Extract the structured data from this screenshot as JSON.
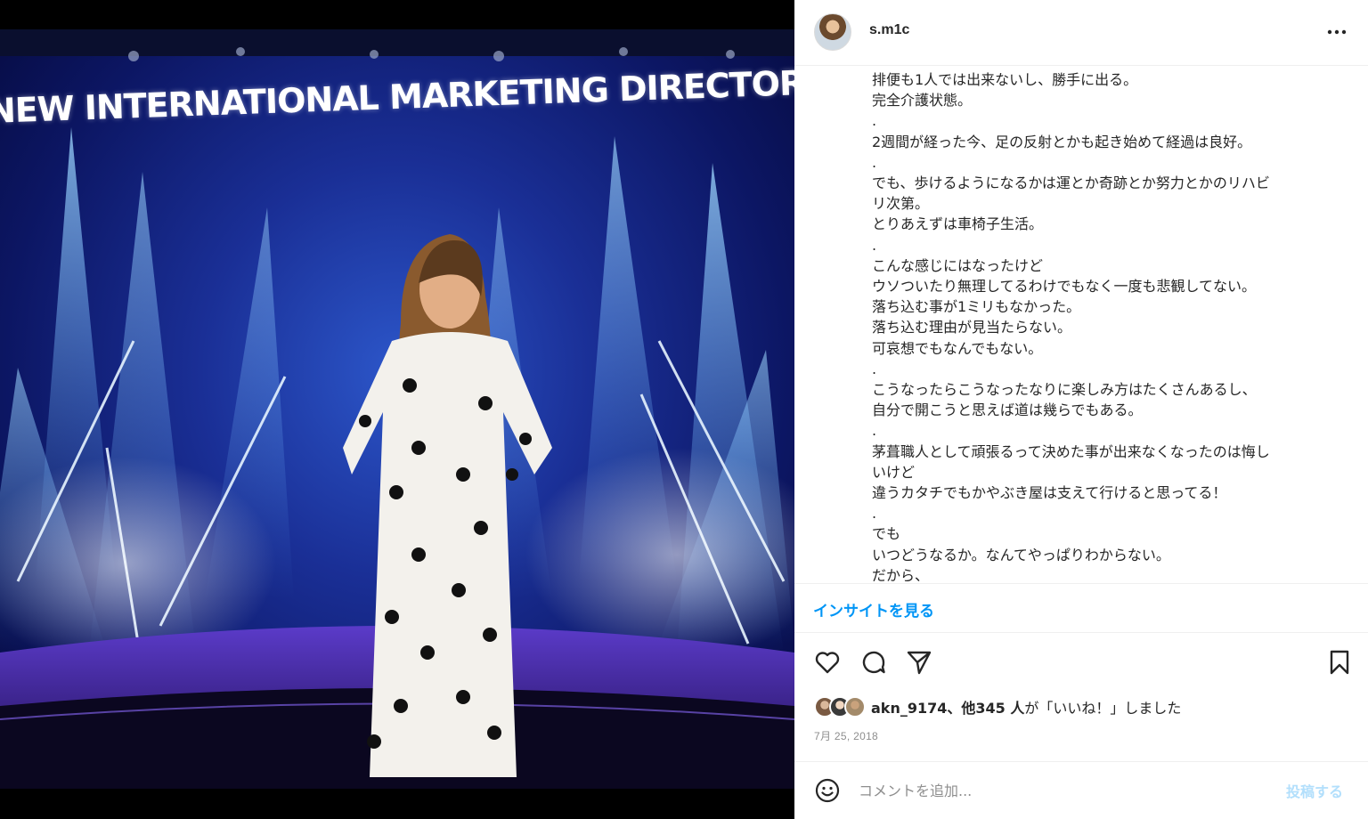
{
  "photo": {
    "stage_text": "NEW INTERNATIONAL MARKETING DIRECTOR"
  },
  "header": {
    "username": "s.m1c",
    "more_icon": "more-horizontal-icon"
  },
  "caption": {
    "lines": [
      "排便も1人では出来ないし、勝手に出る。",
      "完全介護状態。",
      ".",
      "2週間が経った今、足の反射とかも起き始めて経過は良好。",
      ".",
      "でも、歩けるようになるかは運とか奇跡とか努力とかのリハビ",
      "リ次第。",
      "とりあえずは車椅子生活。",
      ".",
      "こんな感じにはなったけど",
      "ウソついたり無理してるわけでもなく一度も悲観してない。",
      "落ち込む事が1ミリもなかった。",
      "落ち込む理由が見当たらない。",
      "可哀想でもなんでもない。",
      ".",
      "こうなったらこうなったなりに楽しみ方はたくさんあるし、",
      "自分で開こうと思えば道は幾らでもある。",
      ".",
      "茅葺職人として頑張るって決めた事が出来なくなったのは悔し",
      "いけど",
      "違うカタチでもかやぶき屋は支えて行けると思ってる！",
      ".",
      "でも",
      "いつどうなるか。なんてやっぱりわからない。",
      "だから、"
    ]
  },
  "insights": {
    "label": "インサイトを見る"
  },
  "actions": {
    "like_icon": "heart-icon",
    "comment_icon": "comment-icon",
    "share_icon": "send-icon",
    "save_icon": "bookmark-icon"
  },
  "likes": {
    "user": "akn_9174",
    "others": "、他345 人",
    "suffix": "が「いいね！」しました"
  },
  "date": "7月 25, 2018",
  "comment": {
    "placeholder": "コメントを追加...",
    "post_label": "投稿する"
  },
  "colors": {
    "link_blue": "#0095f6",
    "post_disabled": "#b2dffc",
    "muted": "#8e8e8e"
  }
}
